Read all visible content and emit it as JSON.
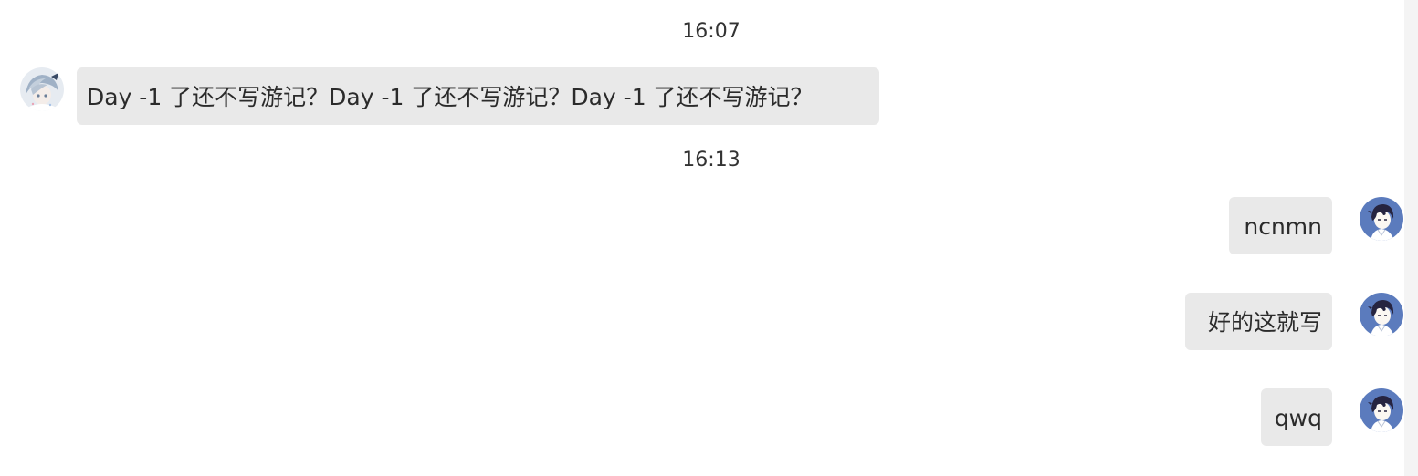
{
  "timestamps": [
    "16:07",
    "16:13"
  ],
  "messages": [
    {
      "side": "left",
      "text": "Day -1 了还不写游记？Day -1 了还不写游记？Day -1 了还不写游记？",
      "avatar": "contact-avatar"
    },
    {
      "side": "right",
      "text": "ncnmn",
      "avatar": "self-avatar"
    },
    {
      "side": "right",
      "text": "好的这就写",
      "avatar": "self-avatar"
    },
    {
      "side": "right",
      "text": "qwq",
      "avatar": "self-avatar"
    }
  ],
  "colors": {
    "bubble": "#e9e9e9",
    "text": "#2b2b2b",
    "self_avatar_bg": "#5b7bbd",
    "contact_avatar_bg": "#dfe6ee"
  }
}
